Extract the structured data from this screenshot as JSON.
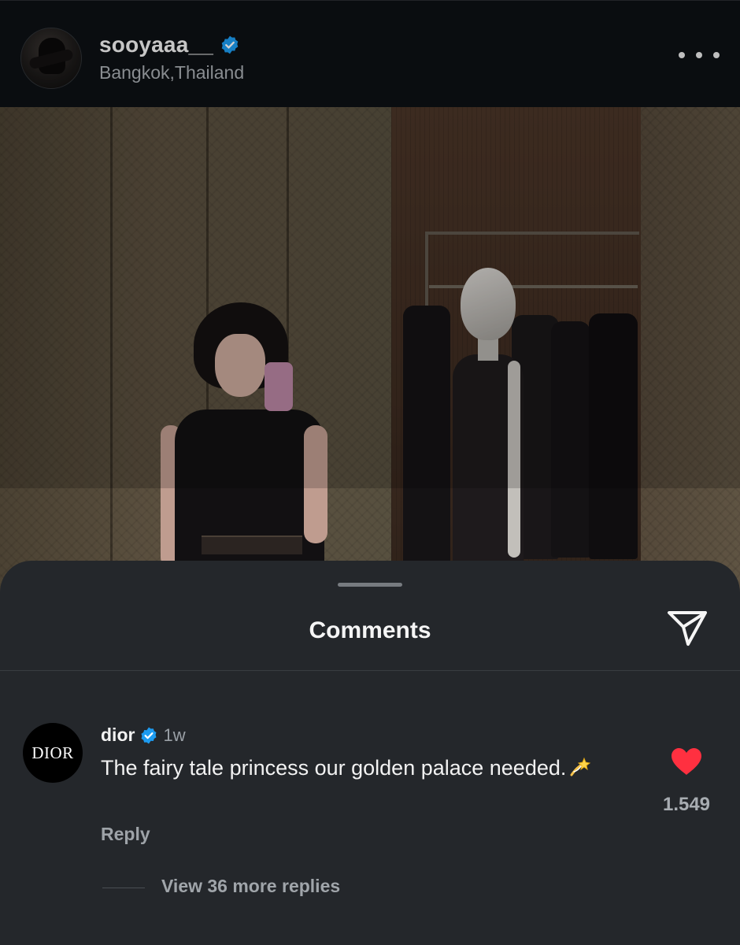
{
  "post": {
    "username": "sooyaaa__",
    "verified": true,
    "location": "Bangkok,Thailand",
    "more_icon": "more-horizontal-icon"
  },
  "sheet": {
    "title": "Comments",
    "share_icon": "send-icon"
  },
  "comments": [
    {
      "avatar_text": "DIOR",
      "username": "dior",
      "verified": true,
      "time": "1w",
      "text": "The fairy tale princess our golden palace needed.",
      "emoji": "dizzy-emoji",
      "reply_label": "Reply",
      "liked": true,
      "like_count": "1.549",
      "view_replies_label": "View 36 more replies"
    }
  ],
  "colors": {
    "verified_blue": "#1d9bf0",
    "like_red": "#ff3040",
    "sheet_bg": "#24272b",
    "header_bg": "#0d1014"
  }
}
